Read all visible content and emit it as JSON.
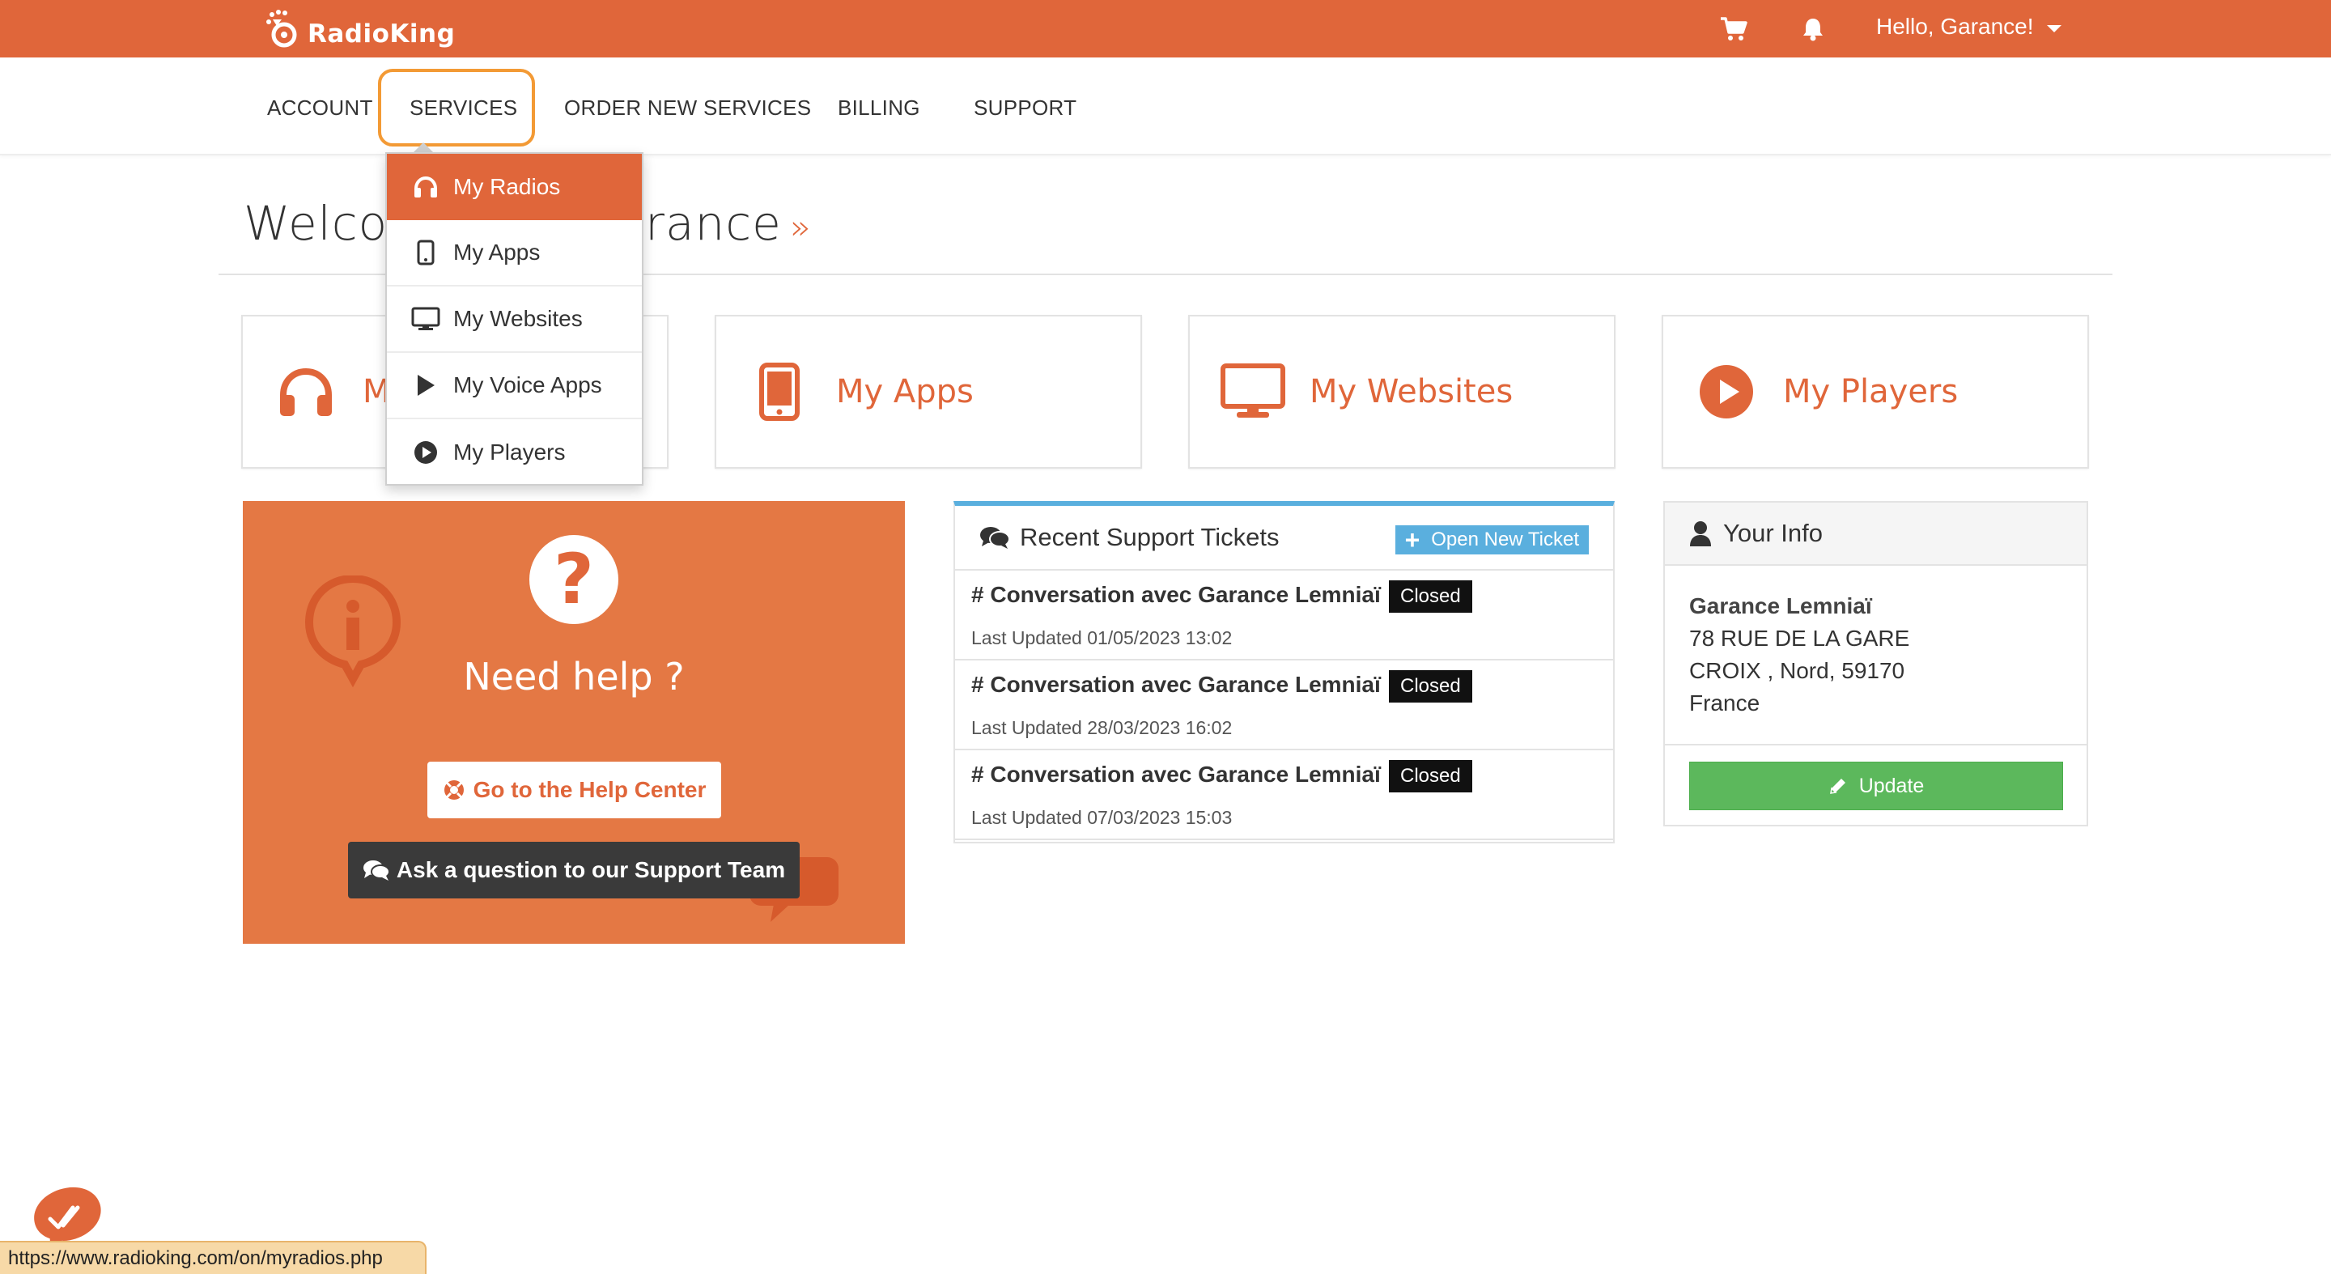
{
  "brand": {
    "name": "RadioKing",
    "accent": "#e0663a"
  },
  "topbar": {
    "cart_icon": "cart-icon",
    "bell_icon": "bell-icon",
    "greeting": "Hello, Garance!"
  },
  "nav": {
    "items": [
      "ACCOUNT",
      "SERVICES",
      "ORDER NEW SERVICES",
      "BILLING",
      "SUPPORT"
    ],
    "highlighted": "SERVICES"
  },
  "dropdown": {
    "items": [
      {
        "label": "My Radios",
        "icon": "headphones-icon",
        "active": true
      },
      {
        "label": "My Apps",
        "icon": "phone-icon",
        "active": false
      },
      {
        "label": "My Websites",
        "icon": "monitor-icon",
        "active": false
      },
      {
        "label": "My Voice Apps",
        "icon": "play-triangle-icon",
        "active": false
      },
      {
        "label": "My Players",
        "icon": "play-circle-icon",
        "active": false
      }
    ]
  },
  "welcome": {
    "left": "Welco",
    "right": "rance",
    "raquo": "»"
  },
  "tiles": [
    {
      "label": "My Radios",
      "visible_label": "My",
      "icon": "headphones-icon"
    },
    {
      "label": "My Apps",
      "icon": "phone-icon"
    },
    {
      "label": "My Websites",
      "icon": "monitor-icon"
    },
    {
      "label": "My Players",
      "icon": "play-circle-icon"
    }
  ],
  "help": {
    "title": "Need help ?",
    "help_center_button": "Go to the Help Center",
    "ask_button": "Ask a question to our Support Team"
  },
  "tickets": {
    "title": "Recent Support Tickets",
    "open_button": "Open New Ticket",
    "items": [
      {
        "subject": "# Conversation avec Garance Lemniaï",
        "status": "Closed",
        "updated": "Last Updated 01/05/2023 13:02"
      },
      {
        "subject": "# Conversation avec Garance Lemniaï",
        "status": "Closed",
        "updated": "Last Updated 28/03/2023 16:02"
      },
      {
        "subject": "# Conversation avec Garance Lemniaï",
        "status": "Closed",
        "updated": "Last Updated 07/03/2023 15:03"
      }
    ]
  },
  "info": {
    "title": "Your Info",
    "name": "Garance Lemniaï",
    "address1": "78 RUE DE LA GARE",
    "address2": "CROIX , Nord, 59170",
    "country": "France",
    "update_button": "Update"
  },
  "status_bar": {
    "url": "https://www.radioking.com/on/myradios.php"
  }
}
